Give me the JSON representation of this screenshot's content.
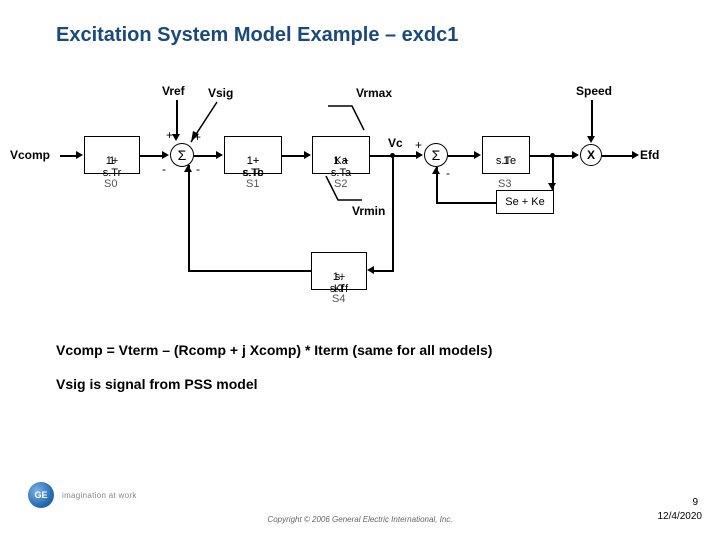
{
  "title": "Excitation System Model Example – exdc1",
  "diagram": {
    "inputs": {
      "vcomp": "Vcomp",
      "vref": "Vref",
      "vsig": "Vsig",
      "speed": "Speed"
    },
    "outputs": {
      "efd": "Efd"
    },
    "limits": {
      "vrmax": "Vrmax",
      "vrmin": "Vrmin"
    },
    "internal": {
      "vc": "Vc"
    },
    "blocks": {
      "s0": {
        "name": "S0",
        "num": "1",
        "den": "1+ s.Tr"
      },
      "s1": {
        "name": "S1",
        "num": "1+ s.Tc",
        "den": "1+ s.Tb"
      },
      "s2": {
        "name": "S2",
        "num": "Ka",
        "den": "1 + s.Ta"
      },
      "s3": {
        "name": "S3",
        "num": "1",
        "den": "s.Te"
      },
      "s4": {
        "name": "S4",
        "num": "s. Kf",
        "den": "1+ s.Tf"
      },
      "se": "Se + Ke"
    },
    "sum_symbol": "Σ",
    "mult_symbol": "X",
    "signs": {
      "plus": "+",
      "minus": "-"
    }
  },
  "equations": {
    "line1": "Vcomp = Vterm – (Rcomp + j Xcomp) * Iterm (same for all models)",
    "line2": "Vsig is signal from PSS model"
  },
  "footer": {
    "logo_text": "GE",
    "tagline": "imagination at work",
    "copyright": "Copyright © 2006 General Electric International, Inc.",
    "page": "9",
    "date": "12/4/2020"
  }
}
